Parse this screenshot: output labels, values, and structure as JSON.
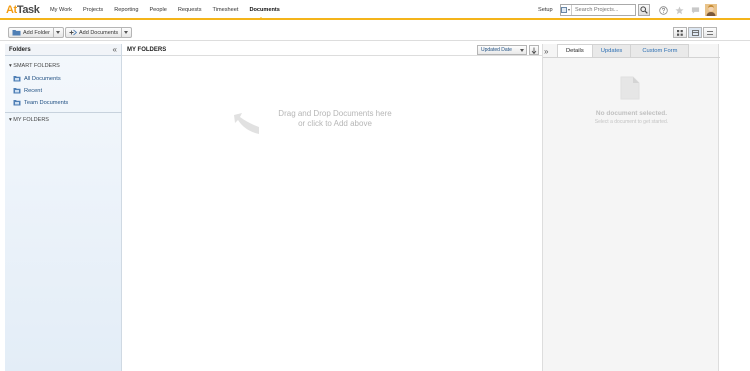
{
  "app": {
    "logo_prefix": "At",
    "logo_suffix": "Task"
  },
  "nav": {
    "links": [
      "My Work",
      "Projects",
      "Reporting",
      "People",
      "Requests",
      "Timesheet",
      "Documents"
    ],
    "active": "Documents",
    "setup_label": "Setup",
    "search_placeholder": "Search Projects...",
    "icons": [
      "search-icon",
      "help-icon",
      "star-icon",
      "chat-icon",
      "avatar"
    ]
  },
  "toolbar": {
    "add_folder_label": "Add Folder",
    "add_documents_label": "Add Documents",
    "view_icons": [
      "grid-view-icon",
      "split-view-icon",
      "list-view-icon"
    ]
  },
  "sidebar": {
    "title": "Folders",
    "collapse_glyph": "«",
    "smart_folders_label": "SMART FOLDERS",
    "smart_folders": [
      "All Documents",
      "Recent",
      "Team Documents"
    ],
    "my_folders_label": "MY FOLDERS"
  },
  "main": {
    "title": "MY FOLDERS",
    "sort_label": "Updated Date",
    "drop_line1": "Drag and Drop Documents here",
    "drop_line2": "or click to Add above",
    "expand_glyph": "»"
  },
  "details": {
    "tabs": [
      "Details",
      "Updates",
      "Custom Form"
    ],
    "active_tab": "Details",
    "empty_title": "No document selected.",
    "empty_subtitle": "Select a document to get started."
  },
  "colors": {
    "accent": "#f4b41a",
    "link": "#1f4f82",
    "tab_link": "#2c6fb3"
  }
}
